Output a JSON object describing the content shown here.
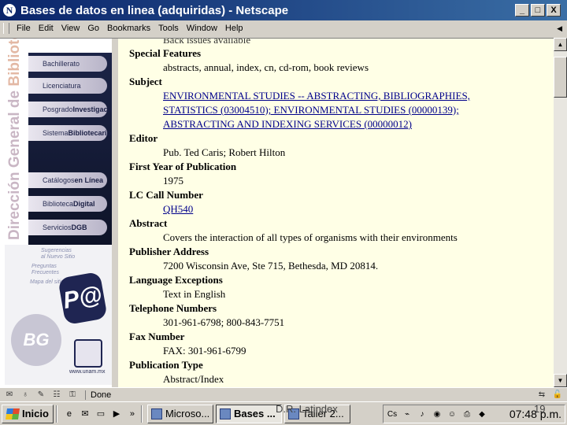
{
  "window": {
    "title": "Bases de datos en linea (adquiridas) - Netscape",
    "minimize_glyph": "_",
    "maximize_glyph": "□",
    "close_glyph": "X"
  },
  "menu": {
    "items": [
      "File",
      "Edit",
      "View",
      "Go",
      "Bookmarks",
      "Tools",
      "Window",
      "Help"
    ]
  },
  "sidebar": {
    "vertical_title_a": "Dirección General de ",
    "vertical_title_b": "Bibliotecas",
    "nav": [
      {
        "pre": "Bachillerato",
        "bold": ""
      },
      {
        "pre": "Licenciatura",
        "bold": ""
      },
      {
        "pre": "Posgrado",
        "bold": "Investigación"
      },
      {
        "pre": "Sistema",
        "bold": "Bibliotecario"
      },
      {
        "pre": "Catálogos",
        "bold": "en Línea"
      },
      {
        "pre": "Biblioteca",
        "bold": "Digital"
      },
      {
        "pre": "Servicios",
        "bold": "DGB"
      }
    ],
    "mini_links": [
      "Sugerencias",
      "al Nuevo Sitio",
      "Preguntas",
      "Frecuentes",
      "Mapa del sitio"
    ],
    "pa_logo": "P@",
    "dgb_logo": "BG",
    "unam_url": "www.unam.mx"
  },
  "record": {
    "cut_text": "Back issues available",
    "fields": [
      {
        "label": "Special Features",
        "lines": [
          {
            "text": "abstracts, annual, index, cn, cd-rom, book reviews",
            "link": false
          }
        ]
      },
      {
        "label": "Subject",
        "lines": [
          {
            "text": "ENVIRONMENTAL STUDIES -- ABSTRACTING, BIBLIOGRAPHIES,",
            "link": true
          },
          {
            "text": "STATISTICS (03004510); ENVIRONMENTAL STUDIES (00000139);",
            "link": true
          },
          {
            "text": "ABSTRACTING AND INDEXING SERVICES (00000012)",
            "link": true
          }
        ]
      },
      {
        "label": "Editor",
        "lines": [
          {
            "text": "Pub. Ted Caris; Robert Hilton",
            "link": false
          }
        ]
      },
      {
        "label": "First Year of Publication",
        "lines": [
          {
            "text": "1975",
            "link": false
          }
        ]
      },
      {
        "label": "LC Call Number",
        "lines": [
          {
            "text": "QH540",
            "link": true
          }
        ]
      },
      {
        "label": "Abstract",
        "lines": [
          {
            "text": "Covers the interaction of all types of organisms with their environments",
            "link": false
          }
        ]
      },
      {
        "label": "Publisher Address",
        "lines": [
          {
            "text": "7200 Wisconsin Ave, Ste 715, Bethesda, MD 20814.",
            "link": false
          }
        ]
      },
      {
        "label": "Language Exceptions",
        "lines": [
          {
            "text": "Text in English",
            "link": false
          }
        ]
      },
      {
        "label": "Telephone Numbers",
        "lines": [
          {
            "text": "301-961-6798; 800-843-7751",
            "link": false
          }
        ]
      },
      {
        "label": "Fax Number",
        "lines": [
          {
            "text": "FAX: 301-961-6799",
            "link": false
          }
        ]
      },
      {
        "label": "Publication Type",
        "lines": [
          {
            "text": "Abstract/Index",
            "link": false
          }
        ]
      }
    ]
  },
  "statusbar": {
    "status": "Done"
  },
  "taskbar": {
    "start_label": "Inicio",
    "tasks": [
      {
        "label": "Microso...",
        "active": false
      },
      {
        "label": "Bases ...",
        "active": true
      },
      {
        "label": "Taller 2...",
        "active": false
      }
    ],
    "clock": "07:48 p.m."
  },
  "slide": {
    "footer": "D.R. Latindex",
    "number": "19"
  }
}
